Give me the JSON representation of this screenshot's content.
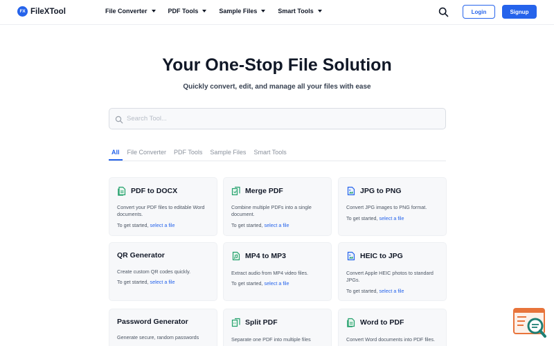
{
  "header": {
    "logo_mark": "FX",
    "logo_text": "FileXTool",
    "nav": [
      {
        "label": "File Converter"
      },
      {
        "label": "PDF Tools"
      },
      {
        "label": "Sample Files"
      },
      {
        "label": "Smart Tools"
      }
    ],
    "login_label": "Login",
    "signup_label": "Signup"
  },
  "hero": {
    "title": "Your One-Stop File Solution",
    "subtitle": "Quickly convert, edit, and manage all your files with ease"
  },
  "search": {
    "placeholder": "Search Tool...",
    "value": ""
  },
  "tabs": [
    {
      "label": "All",
      "active": true
    },
    {
      "label": "File Converter",
      "active": false
    },
    {
      "label": "PDF Tools",
      "active": false
    },
    {
      "label": "Sample Files",
      "active": false
    },
    {
      "label": "Smart Tools",
      "active": false
    }
  ],
  "cards": [
    {
      "title": "PDF to DOCX",
      "icon": "docx-file-icon",
      "desc": "Convert your PDF files to editable Word documents.",
      "cta_prefix": "To get started,",
      "cta_link": "select a file"
    },
    {
      "title": "Merge PDF",
      "icon": "merge-pdf-icon",
      "desc": "Combine multiple PDFs into a single document.",
      "cta_prefix": "To get started,",
      "cta_link": "select a file"
    },
    {
      "title": "JPG to PNG",
      "icon": "image-file-icon",
      "desc": "Convert JPG images to PNG format.",
      "cta_prefix": "To get started,",
      "cta_link": "select a file"
    },
    {
      "title": "QR Generator",
      "icon": "",
      "desc": "Create custom QR codes quickly.",
      "cta_prefix": "To get started,",
      "cta_link": "select a file"
    },
    {
      "title": "MP4 to MP3",
      "icon": "audio-file-icon",
      "desc": "Extract audio from MP4 video files.",
      "cta_prefix": "To get started,",
      "cta_link": "select a file"
    },
    {
      "title": "HEIC to JPG",
      "icon": "image-file-icon",
      "desc": "Convert Apple HEIC photos to standard JPGs.",
      "cta_prefix": "To get started,",
      "cta_link": "select a file"
    },
    {
      "title": "Password Generator",
      "icon": "",
      "desc": "Generate secure, random passwords",
      "cta_prefix": "",
      "cta_link": ""
    },
    {
      "title": "Split PDF",
      "icon": "split-pdf-icon",
      "desc": "Separate one PDF into multiple files",
      "cta_prefix": "",
      "cta_link": ""
    },
    {
      "title": "Word to PDF",
      "icon": "pdf-file-icon",
      "desc": "Convert Word documents into PDF files.",
      "cta_prefix": "",
      "cta_link": ""
    }
  ],
  "colors": {
    "accent": "#2563eb",
    "icon_green": "#22a06b",
    "icon_blue": "#2563eb",
    "fab_orange": "#e8743b",
    "fab_teal": "#1e7f74"
  }
}
